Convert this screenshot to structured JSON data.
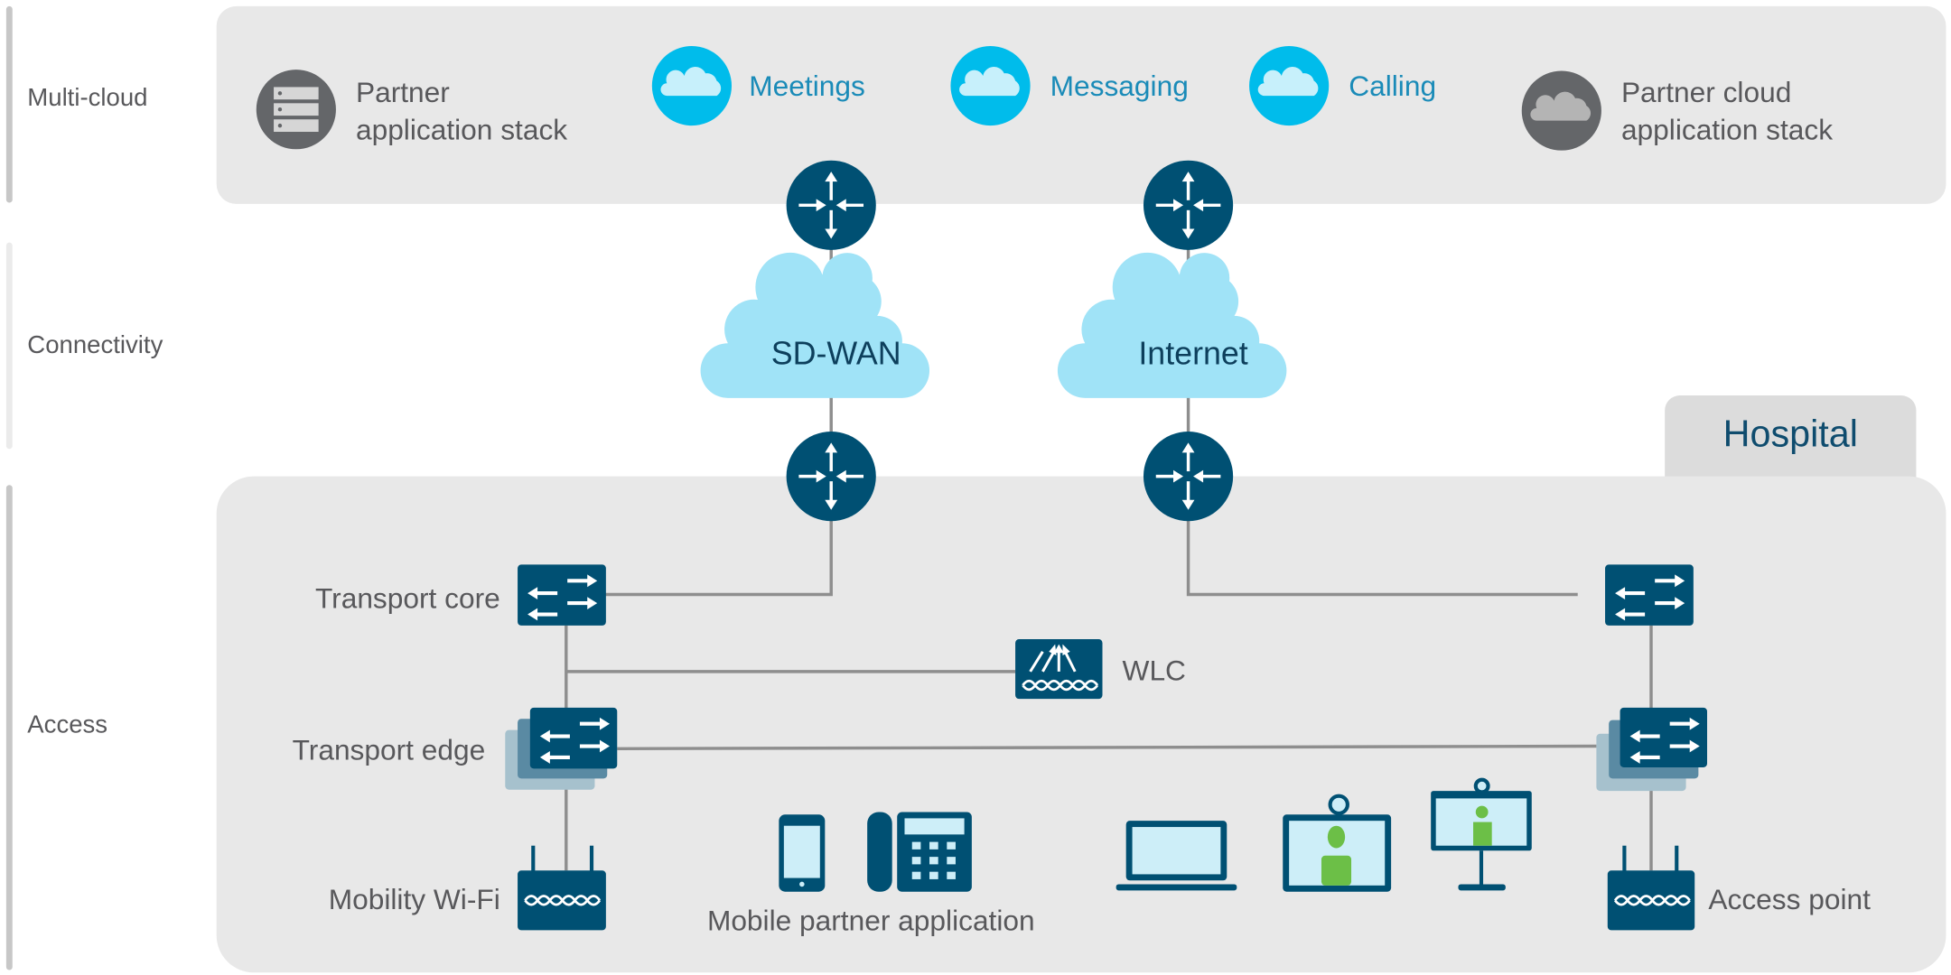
{
  "layers": {
    "multicloud": "Multi-cloud",
    "connectivity": "Connectivity",
    "access": "Access"
  },
  "multicloud": {
    "partner_stack": [
      "Partner",
      "application stack"
    ],
    "services": [
      "Meetings",
      "Messaging",
      "Calling"
    ],
    "partner_cloud": [
      "Partner cloud",
      "application stack"
    ]
  },
  "connectivity": {
    "sdwan": "SD-WAN",
    "internet": "Internet"
  },
  "access": {
    "site": "Hospital",
    "transport_core": "Transport core",
    "wlc": "WLC",
    "transport_edge": "Transport edge",
    "mobility_wifi": "Mobility Wi-Fi",
    "mobile_partner_app": "Mobile partner application",
    "access_point": "Access point"
  },
  "colors": {
    "device": "#005073",
    "service": "#00bceb",
    "cloud": "#a0e3f7",
    "panel": "#e8e8e8",
    "person": "#6cbf47"
  },
  "icons": [
    "server-stack-icon",
    "cloud-icon",
    "router-icon",
    "switch-icon",
    "wlc-icon",
    "access-point-icon",
    "mobile-phone-icon",
    "ip-phone-icon",
    "laptop-icon",
    "video-endpoint-icon",
    "video-display-icon"
  ]
}
